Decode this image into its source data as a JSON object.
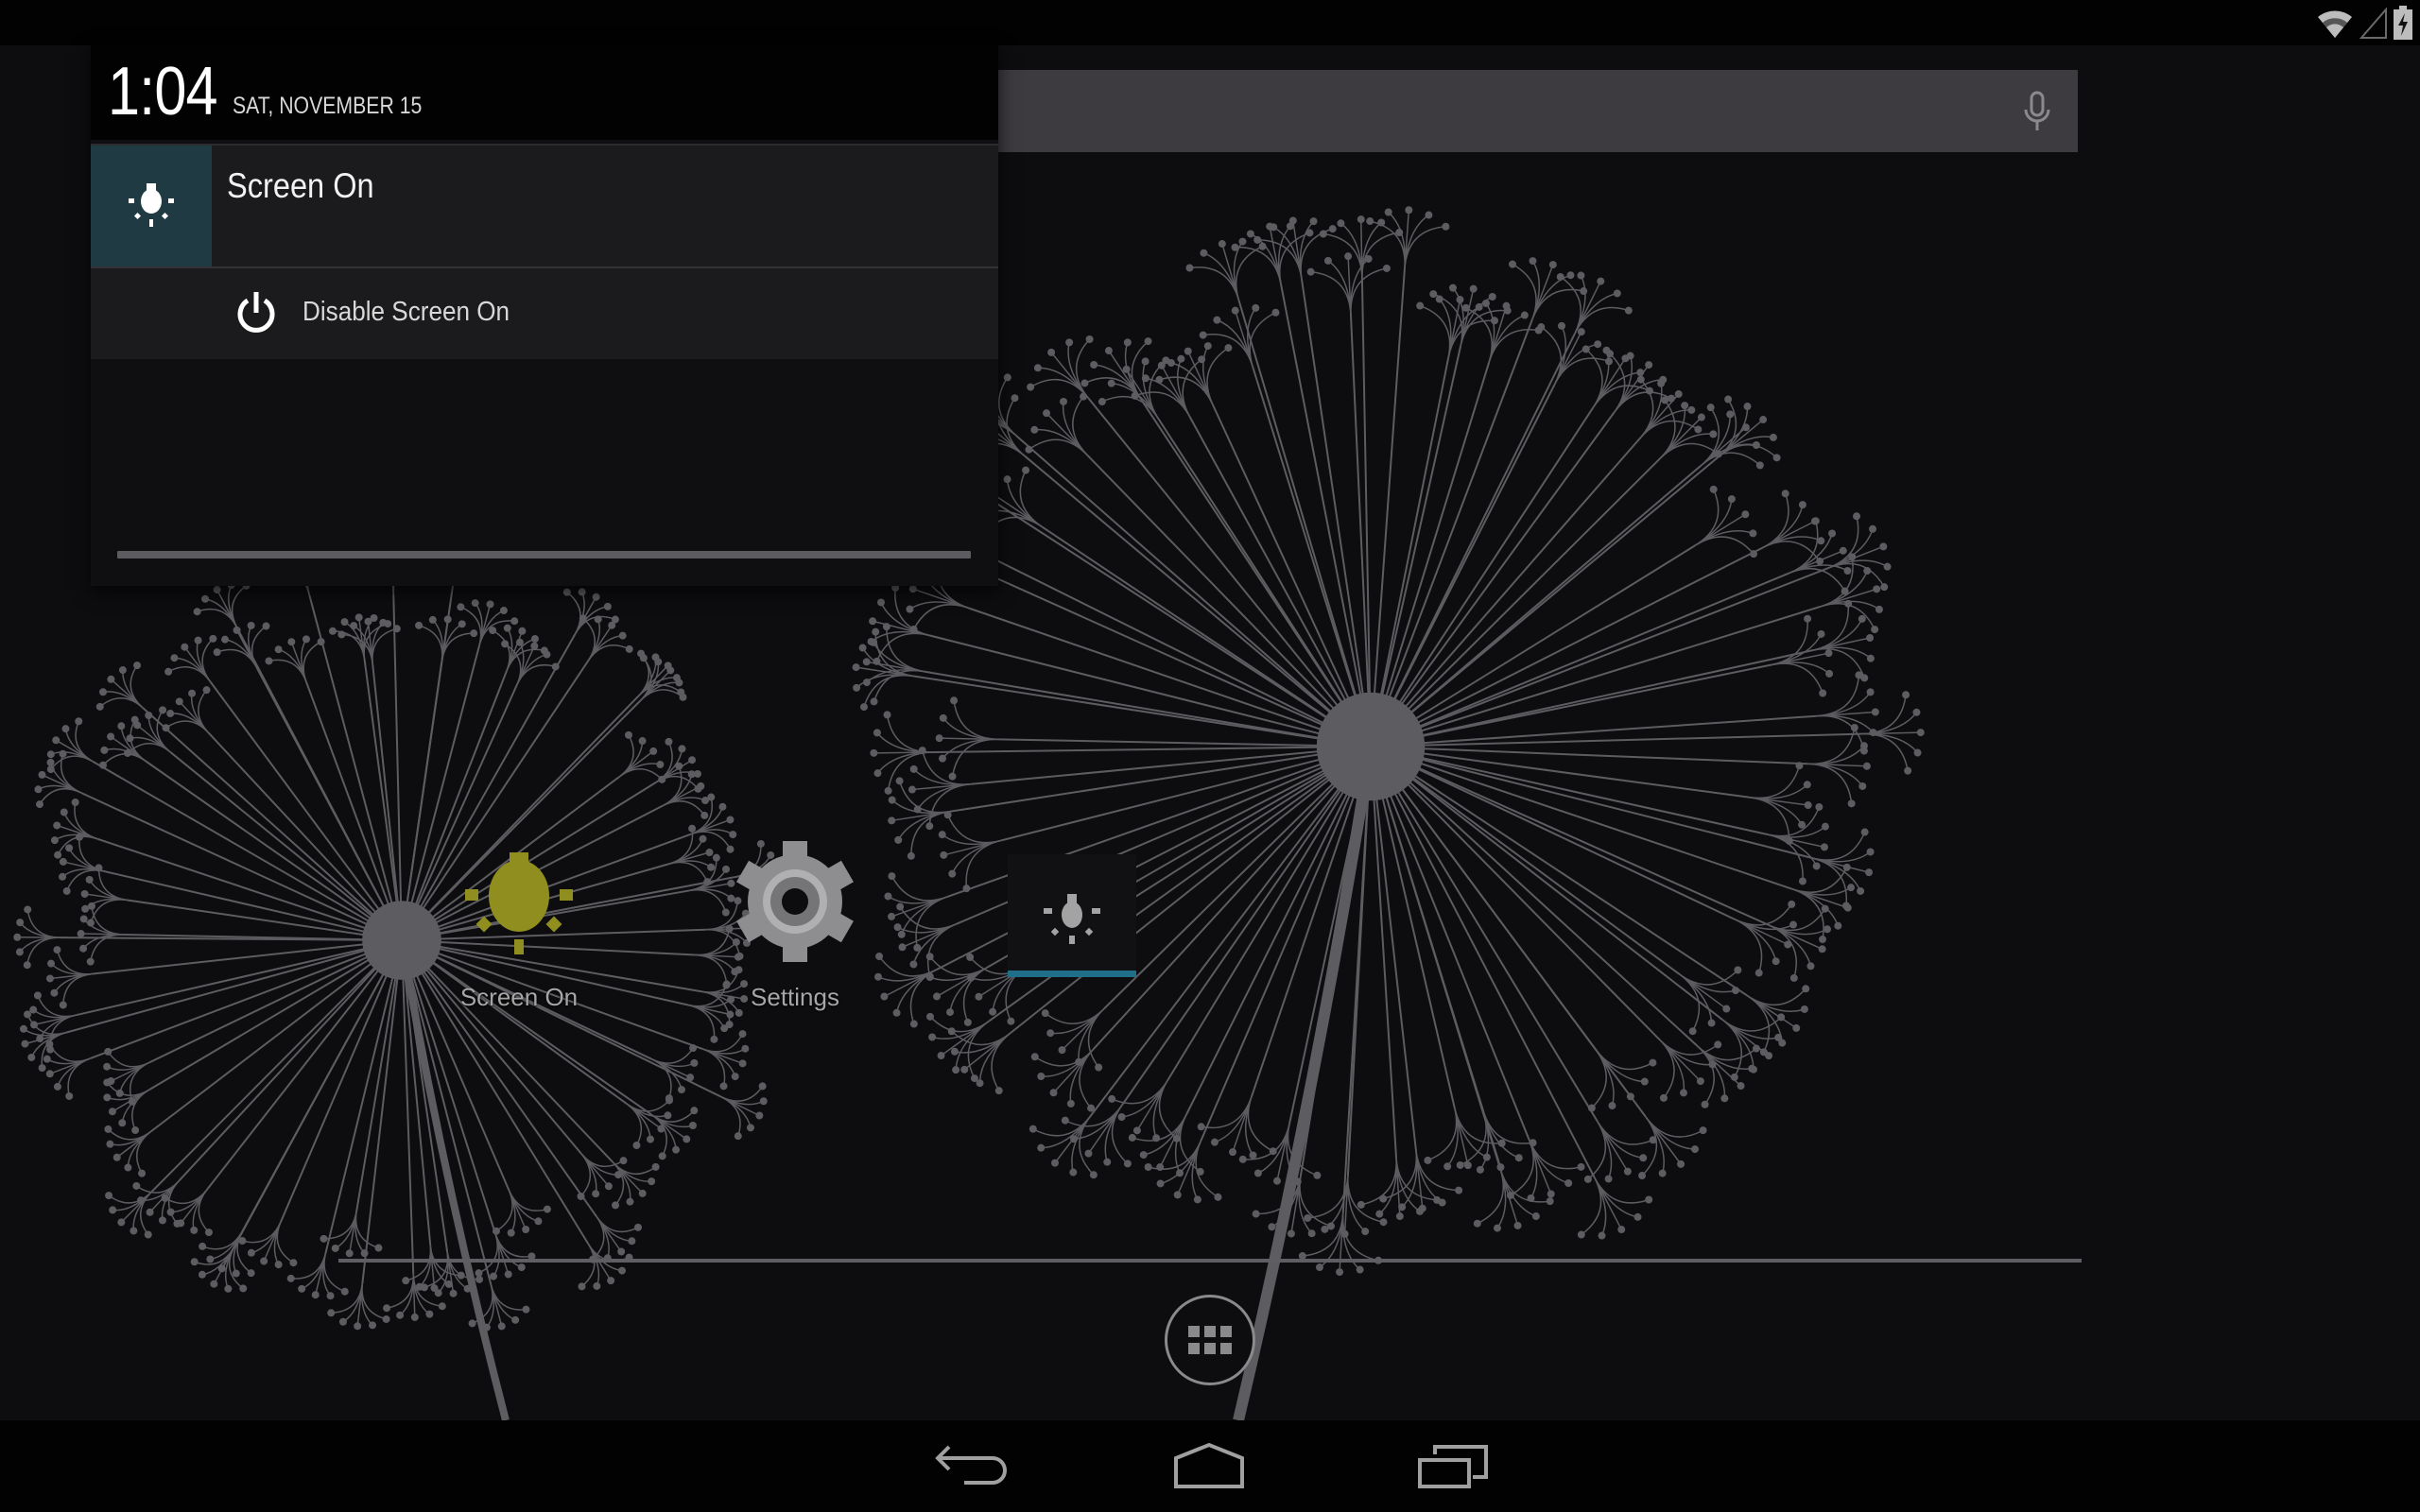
{
  "status_bar": {
    "icons": [
      "wifi-icon",
      "cell-signal-icon",
      "battery-charging-icon"
    ]
  },
  "notification_shade": {
    "clock": "1:04",
    "date": "SAT, NOVEMBER 15",
    "notifications": [
      {
        "icon": "lightbulb-icon",
        "title": "Screen On",
        "actions": [
          {
            "icon": "power-icon",
            "label": "Disable Screen On"
          }
        ]
      }
    ]
  },
  "search": {
    "placeholder": "",
    "voice_icon": "mic-icon"
  },
  "home": {
    "apps": [
      {
        "label": "Screen On",
        "icon": "lightbulb-icon",
        "color": "#8f8e1f"
      },
      {
        "label": "Settings",
        "icon": "gear-icon",
        "color": "#8e8d90"
      }
    ],
    "widget": {
      "icon": "lightbulb-icon",
      "accent": "#1f6f8b"
    },
    "app_drawer_icon": "apps-grid-icon"
  },
  "nav_bar": {
    "buttons": [
      "back-icon",
      "home-icon",
      "recents-icon"
    ]
  },
  "colors": {
    "notification_icon_bg": "#203a44",
    "widget_accent": "#1f6f8b",
    "app_accent": "#8f8e1f"
  }
}
